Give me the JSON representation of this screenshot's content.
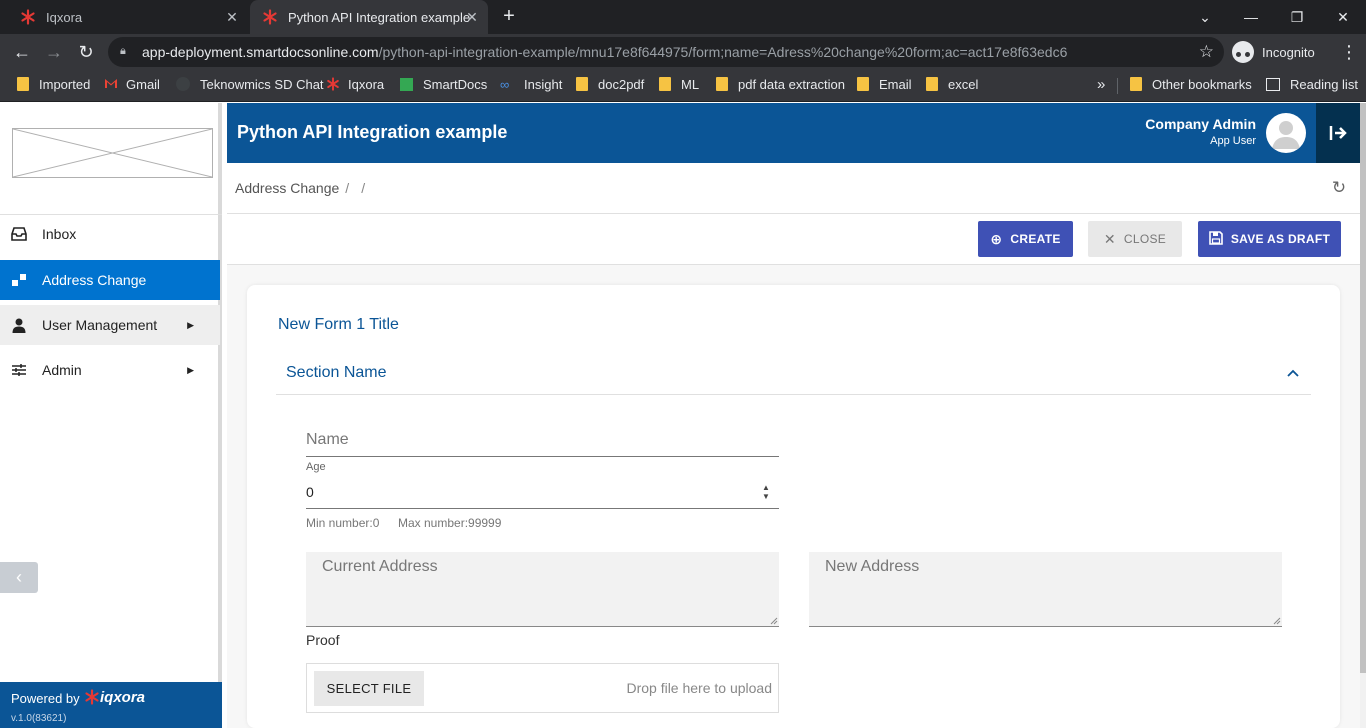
{
  "browser": {
    "tabs": [
      {
        "label": "Iqxora",
        "active": false
      },
      {
        "label": "Python API Integration example",
        "active": true
      }
    ],
    "address": {
      "host": "app-deployment.smartdocsonline.com",
      "path": "/python-api-integration-example/mnu17e8f644975/form;name=Adress%20change%20form;ac=act17e8f63edc6"
    },
    "profile_label": "Incognito",
    "bookmarks": [
      {
        "label": "Imported",
        "icon": "folder-icon"
      },
      {
        "label": "Gmail",
        "icon": "gmail-icon"
      },
      {
        "label": "Teknowmics SD Chat",
        "icon": "chat-icon"
      },
      {
        "label": "Iqxora",
        "icon": "iqxora-icon"
      },
      {
        "label": "SmartDocs",
        "icon": "smartdocs-icon"
      },
      {
        "label": "Insight",
        "icon": "insight-icon"
      },
      {
        "label": "doc2pdf",
        "icon": "folder-icon"
      },
      {
        "label": "ML",
        "icon": "folder-icon"
      },
      {
        "label": "pdf data extraction",
        "icon": "folder-icon"
      },
      {
        "label": "Email",
        "icon": "folder-icon"
      },
      {
        "label": "excel",
        "icon": "folder-icon"
      }
    ],
    "overflow_label": "»",
    "other_bookmarks": "Other bookmarks",
    "reading_list": "Reading list"
  },
  "app": {
    "title": "Python API Integration example",
    "user": {
      "name": "Company Admin",
      "role": "App User"
    },
    "breadcrumb": [
      "Address Change",
      ""
    ],
    "sidebar": {
      "items": [
        {
          "label": "Inbox",
          "icon": "inbox-icon"
        },
        {
          "label": "Address Change",
          "icon": "form-icon"
        },
        {
          "label": "User Management",
          "icon": "user-icon"
        },
        {
          "label": "Admin",
          "icon": "settings-sliders-icon"
        }
      ],
      "powered_by": "Powered by",
      "brand": "iqxora",
      "version": "v.1.0(83621)"
    },
    "actions": {
      "create": "CREATE",
      "close": "CLOSE",
      "save_draft": "SAVE AS DRAFT"
    },
    "form": {
      "title": "New Form 1 Title",
      "section": "Section Name",
      "name_placeholder": "Name",
      "age_label": "Age",
      "age_value": "0",
      "min_hint": "Min number:0",
      "max_hint": "Max number:99999",
      "current_address_placeholder": "Current Address",
      "new_address_placeholder": "New Address",
      "proof_label": "Proof",
      "select_file": "SELECT FILE",
      "drop_hint": "Drop file here to upload"
    }
  },
  "colors": {
    "header": "#0b5596",
    "active_nav": "#0073cf",
    "primary_button": "#3f51b5"
  }
}
